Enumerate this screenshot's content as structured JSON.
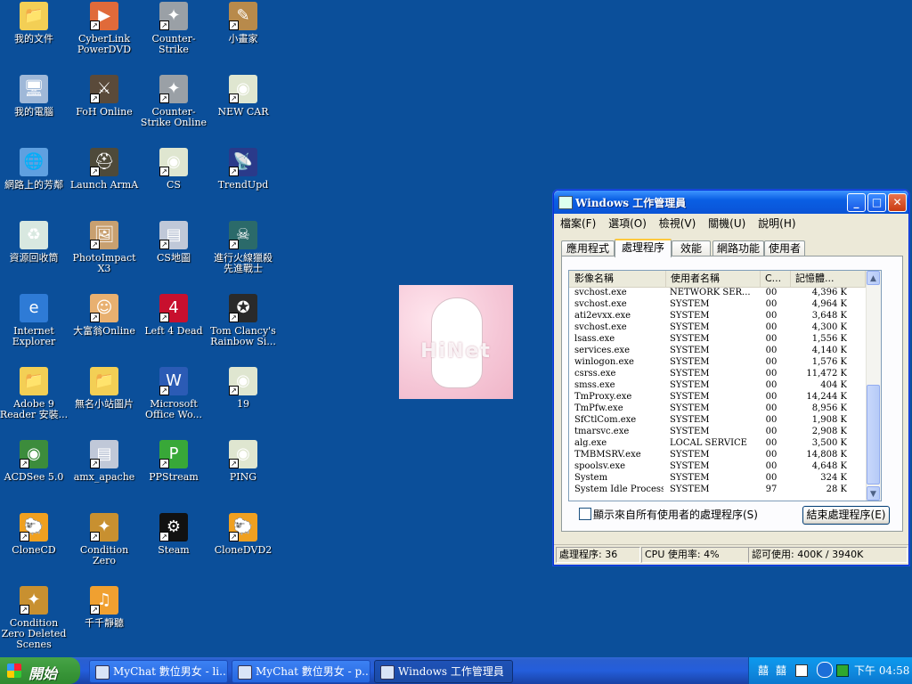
{
  "desktop": {
    "icons": [
      {
        "label": "我的文件",
        "icon": "my-documents-icon",
        "color": "#f3cf55",
        "glyph": "📁",
        "shortcut": false
      },
      {
        "label": "CyberLink PowerDVD",
        "icon": "powerdvd-icon",
        "color": "#e06a3a",
        "glyph": "▶",
        "shortcut": true
      },
      {
        "label": "Counter-Strike",
        "icon": "counter-strike-icon",
        "color": "#9aa0a6",
        "glyph": "✦",
        "shortcut": true
      },
      {
        "label": "小畫家",
        "icon": "paint-icon",
        "color": "#b88a4b",
        "glyph": "✎",
        "shortcut": true
      },
      {
        "label": "我的電腦",
        "icon": "my-computer-icon",
        "color": "#9fb8d8",
        "glyph": "🖥",
        "shortcut": false
      },
      {
        "label": "FoH Online",
        "icon": "foh-online-icon",
        "color": "#5a4a3a",
        "glyph": "⚔",
        "shortcut": true
      },
      {
        "label": "Counter-Strike Online",
        "icon": "counter-strike-online-icon",
        "color": "#9aa0a6",
        "glyph": "✦",
        "shortcut": true
      },
      {
        "label": "NEW CAR",
        "icon": "acdsee-eye-icon",
        "color": "#dfe6d0",
        "glyph": "◉",
        "shortcut": true
      },
      {
        "label": "網路上的芳鄰",
        "icon": "network-places-icon",
        "color": "#5fa0e0",
        "glyph": "🌐",
        "shortcut": false
      },
      {
        "label": "Launch ArmA",
        "icon": "arma-icon",
        "color": "#4e4a3a",
        "glyph": "⛑",
        "shortcut": true
      },
      {
        "label": "CS",
        "icon": "acdsee-eye-icon",
        "color": "#dfe6d0",
        "glyph": "◉",
        "shortcut": true
      },
      {
        "label": "TrendUpd",
        "icon": "trend-update-icon",
        "color": "#2a3a8a",
        "glyph": "📡",
        "shortcut": true
      },
      {
        "label": "資源回收筒",
        "icon": "recycle-bin-icon",
        "color": "#d8e8e0",
        "glyph": "♻",
        "shortcut": false
      },
      {
        "label": "PhotoImpact X3",
        "icon": "photoimpact-icon",
        "color": "#c8a070",
        "glyph": "🖼",
        "shortcut": true
      },
      {
        "label": "CS地圖",
        "icon": "cs-map-icon",
        "color": "#c0c8d8",
        "glyph": "▤",
        "shortcut": true
      },
      {
        "label": "進行火線獵殺 先進戰士",
        "icon": "ghost-recon-icon",
        "color": "#2b6a6a",
        "glyph": "☠",
        "shortcut": true
      },
      {
        "label": "Internet Explorer",
        "icon": "internet-explorer-icon",
        "color": "#2e7bd6",
        "glyph": "e",
        "shortcut": false
      },
      {
        "label": "大富翁Online",
        "icon": "richman-online-icon",
        "color": "#e8b070",
        "glyph": "☺",
        "shortcut": true
      },
      {
        "label": "Left 4 Dead",
        "icon": "left4dead-icon",
        "color": "#c8102e",
        "glyph": "4",
        "shortcut": true
      },
      {
        "label": "Tom Clancy's Rainbow Si...",
        "icon": "rainbow-six-icon",
        "color": "#2a2a2a",
        "glyph": "✪",
        "shortcut": true
      },
      {
        "label": "Adobe 9 Reader 安裝...",
        "icon": "folder-icon",
        "color": "#f3cf55",
        "glyph": "📁",
        "shortcut": false
      },
      {
        "label": "無名小站圖片",
        "icon": "folder-icon",
        "color": "#f3cf55",
        "glyph": "📁",
        "shortcut": false
      },
      {
        "label": "Microsoft Office Wo...",
        "icon": "word-icon",
        "color": "#2b5bb5",
        "glyph": "W",
        "shortcut": true
      },
      {
        "label": "19",
        "icon": "acdsee-eye-icon",
        "color": "#dfe6d0",
        "glyph": "◉",
        "shortcut": true
      },
      {
        "label": "ACDSee 5.0",
        "icon": "acdsee-icon",
        "color": "#3c8c3c",
        "glyph": "◉",
        "shortcut": true
      },
      {
        "label": "amx_apache",
        "icon": "amx-apache-icon",
        "color": "#c0c8d8",
        "glyph": "▤",
        "shortcut": true
      },
      {
        "label": "PPStream",
        "icon": "ppstream-icon",
        "color": "#38a838",
        "glyph": "P",
        "shortcut": true
      },
      {
        "label": "PING",
        "icon": "acdsee-eye-icon",
        "color": "#dfe6d0",
        "glyph": "◉",
        "shortcut": true
      },
      {
        "label": "CloneCD",
        "icon": "clonecd-icon",
        "color": "#f0a020",
        "glyph": "🐑",
        "shortcut": true
      },
      {
        "label": "Condition Zero",
        "icon": "condition-zero-icon",
        "color": "#c89030",
        "glyph": "✦",
        "shortcut": true
      },
      {
        "label": "Steam",
        "icon": "steam-icon",
        "color": "#111111",
        "glyph": "⚙",
        "shortcut": true
      },
      {
        "label": "CloneDVD2",
        "icon": "clonedvd-icon",
        "color": "#f0a020",
        "glyph": "🐑",
        "shortcut": true
      },
      {
        "label": "Condition Zero Deleted Scenes",
        "icon": "condition-zero-icon",
        "color": "#c89030",
        "glyph": "✦",
        "shortcut": true
      },
      {
        "label": "千千靜聽",
        "icon": "ttplayer-icon",
        "color": "#f0a030",
        "glyph": "♫",
        "shortcut": true
      }
    ],
    "wallpaper_text": "HiNet"
  },
  "task_manager": {
    "title": "Windows 工作管理員",
    "menu": [
      "檔案(F)",
      "選項(O)",
      "檢視(V)",
      "關機(U)",
      "說明(H)"
    ],
    "tabs": [
      "應用程式",
      "處理程序",
      "效能",
      "網路功能",
      "使用者"
    ],
    "active_tab": "處理程序",
    "columns": [
      "影像名稱",
      "使用者名稱",
      "C...",
      "記憶體..."
    ],
    "rows": [
      [
        "svchost.exe",
        "NETWORK SER...",
        "00",
        "4,396 K"
      ],
      [
        "svchost.exe",
        "SYSTEM",
        "00",
        "4,964 K"
      ],
      [
        "ati2evxx.exe",
        "SYSTEM",
        "00",
        "3,648 K"
      ],
      [
        "svchost.exe",
        "SYSTEM",
        "00",
        "4,300 K"
      ],
      [
        "lsass.exe",
        "SYSTEM",
        "00",
        "1,556 K"
      ],
      [
        "services.exe",
        "SYSTEM",
        "00",
        "4,140 K"
      ],
      [
        "winlogon.exe",
        "SYSTEM",
        "00",
        "1,576 K"
      ],
      [
        "csrss.exe",
        "SYSTEM",
        "00",
        "11,472 K"
      ],
      [
        "smss.exe",
        "SYSTEM",
        "00",
        "404 K"
      ],
      [
        "TmProxy.exe",
        "SYSTEM",
        "00",
        "14,244 K"
      ],
      [
        "TmPfw.exe",
        "SYSTEM",
        "00",
        "8,956 K"
      ],
      [
        "SfCtlCom.exe",
        "SYSTEM",
        "00",
        "1,908 K"
      ],
      [
        "tmarsvc.exe",
        "SYSTEM",
        "00",
        "2,908 K"
      ],
      [
        "alg.exe",
        "LOCAL SERVICE",
        "00",
        "3,500 K"
      ],
      [
        "TMBMSRV.exe",
        "SYSTEM",
        "00",
        "14,808 K"
      ],
      [
        "spoolsv.exe",
        "SYSTEM",
        "00",
        "4,648 K"
      ],
      [
        "System",
        "SYSTEM",
        "00",
        "324 K"
      ],
      [
        "System Idle Process",
        "SYSTEM",
        "97",
        "28 K"
      ]
    ],
    "show_all_users_label": "顯示來自所有使用者的處理程序(S)",
    "end_process_label": "結束處理程序(E)",
    "status": {
      "processes": "處理程序: 36",
      "cpu": "CPU 使用率: 4%",
      "commit": "認可使用: 400K / 3940K"
    }
  },
  "taskbar": {
    "start_label": "開始",
    "tasks": [
      {
        "label": "MyChat 數位男女 - li...",
        "active": false
      },
      {
        "label": "MyChat 數位男女 - p...",
        "active": false
      },
      {
        "label": "Windows 工作管理員",
        "active": true
      }
    ],
    "tray_ime_1": "囍",
    "tray_ime_2": "囍",
    "clock": "下午 04:58"
  },
  "colors": {
    "desktop_bg": "#0b4f9a",
    "titlebar": "#0a5fe4",
    "start_green": "#3c9a3c"
  }
}
